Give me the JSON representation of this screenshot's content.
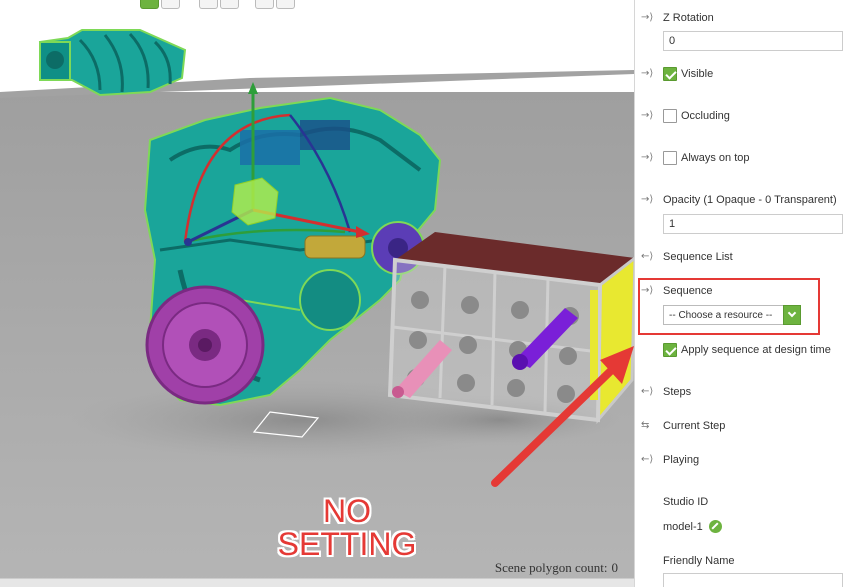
{
  "viewport": {
    "annotation": "NO\nSETTING",
    "annotation_line1": "NO",
    "annotation_line2": "SETTING",
    "polygon_count_label": "Scene polygon count:",
    "polygon_count_value": "0",
    "colors": {
      "annotation": "#e53935",
      "floor": "#a9a9a9",
      "engine_block": "#1aa59a",
      "flywheel": "#a040a8",
      "gizmo_x": "#d32f2f",
      "gizmo_y": "#2e9e3a",
      "gizmo_z": "#283593",
      "accent": "#6db33f"
    }
  },
  "panel": {
    "z_rotation": {
      "label": "Z Rotation",
      "value": "0"
    },
    "visible": {
      "label": "Visible",
      "checked": true
    },
    "occluding": {
      "label": "Occluding",
      "checked": false
    },
    "always_on_top": {
      "label": "Always on top",
      "checked": false
    },
    "opacity": {
      "label": "Opacity (1 Opaque - 0 Transparent)",
      "value": "1"
    },
    "sequence_list": {
      "label": "Sequence List"
    },
    "sequence": {
      "label": "Sequence",
      "placeholder": "-- Choose a resource --"
    },
    "apply_sequence": {
      "label": "Apply sequence at design time",
      "checked": true
    },
    "steps": {
      "label": "Steps"
    },
    "current_step": {
      "label": "Current Step"
    },
    "playing": {
      "label": "Playing"
    },
    "studio_id": {
      "label": "Studio ID",
      "value": "model-1"
    },
    "friendly_name": {
      "label": "Friendly Name"
    }
  },
  "icons": {
    "bind_in": "arrow-into-bracket-icon",
    "bind_out": "arrow-out-icon",
    "bind_both": "two-way-bind-icon",
    "edit": "pencil-icon"
  }
}
